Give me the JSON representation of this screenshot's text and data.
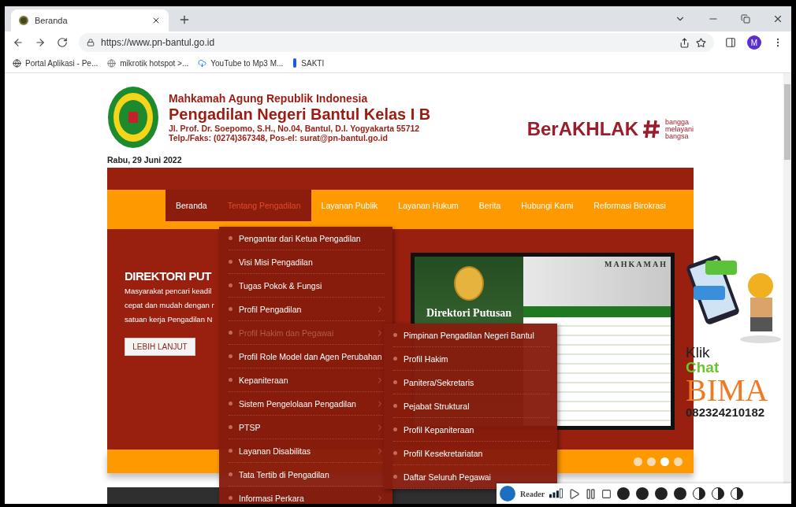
{
  "browser": {
    "tab": {
      "title": "Beranda"
    },
    "url": "https://www.pn-bantul.go.id",
    "bookmarks": [
      "Portal Aplikasi - Pe...",
      "mikrotik hotspot >...",
      "YouTube to Mp3 M...",
      "SAKTI"
    ],
    "profile": "M"
  },
  "header": {
    "org": "Mahkamah Agung Republik Indonesia",
    "title": "Pengadilan Negeri Bantul Kelas I B",
    "address": "Jl. Prof. Dr. Soepomo, S.H., No.04, Bantul, D.I. Yogyakarta 55712",
    "contact": "Telp./Faks: (0274)367348, Pos-el: surat@pn-bantul.go.id",
    "brand": "BerAKHLAK",
    "tagline": [
      "bangga",
      "melayani",
      "bangsa"
    ],
    "date": "Rabu, 29 Juni 2022"
  },
  "nav": [
    {
      "label": "Beranda",
      "current": true,
      "selected": false
    },
    {
      "label": "Tentang Pengadilan",
      "current": false,
      "selected": true
    },
    {
      "label": "Layanan Publik",
      "current": false,
      "selected": false
    },
    {
      "label": "Layanan Hukum",
      "current": false,
      "selected": false
    },
    {
      "label": "Berita",
      "current": false,
      "selected": false
    },
    {
      "label": "Hubungi Kami",
      "current": false,
      "selected": false
    },
    {
      "label": "Reformasi Birokrasi",
      "current": false,
      "selected": false
    }
  ],
  "dropdown": [
    {
      "label": "Pengantar dari Ketua Pengadilan",
      "submenu": false,
      "selected": false
    },
    {
      "label": "Visi Misi Pengadilan",
      "submenu": false,
      "selected": false
    },
    {
      "label": "Tugas Pokok & Fungsi",
      "submenu": false,
      "selected": false
    },
    {
      "label": "Profil Pengadilan",
      "submenu": true,
      "selected": false
    },
    {
      "label": "Profil Hakim dan Pegawai",
      "submenu": true,
      "selected": true
    },
    {
      "label": "Profil Role Model dan Agen Perubahan",
      "submenu": false,
      "selected": false
    },
    {
      "label": "Kepaniteraan",
      "submenu": true,
      "selected": false
    },
    {
      "label": "Sistem Pengelolaan Pengadilan",
      "submenu": true,
      "selected": false
    },
    {
      "label": "PTSP",
      "submenu": true,
      "selected": false
    },
    {
      "label": "Layanan Disabilitas",
      "submenu": true,
      "selected": false
    },
    {
      "label": "Tata Tertib di Pengadilan",
      "submenu": false,
      "selected": false
    },
    {
      "label": "Informasi Perkara",
      "submenu": true,
      "selected": false
    }
  ],
  "submenu": [
    "Pimpinan Pengadilan Negeri Bantul",
    "Profil Hakim",
    "Panitera/Sekretaris",
    "Pejabat Struktural",
    "Profil Kepaniteraan",
    "Profil Kesekretariatan",
    "Daftar Seluruh Pegawai"
  ],
  "hero": {
    "title": "DIREKTORI PUT",
    "lines": [
      "Masyarakat pencari keadil",
      "cepat dan mudah dengan r",
      "satuan kerja Pengadilan N"
    ],
    "button": "LEBIH LANJUT",
    "image": {
      "title": "Direktori Putusan",
      "banner": "MAHKAMAH"
    },
    "slides": [
      {
        "selected": false
      },
      {
        "selected": false
      },
      {
        "selected": true
      },
      {
        "selected": false
      }
    ]
  },
  "chat_widget": {
    "klik": "Klik",
    "chat": "Chat",
    "name": "BIMA",
    "phone": "082324210182"
  },
  "reader": {
    "label": "Reader"
  }
}
